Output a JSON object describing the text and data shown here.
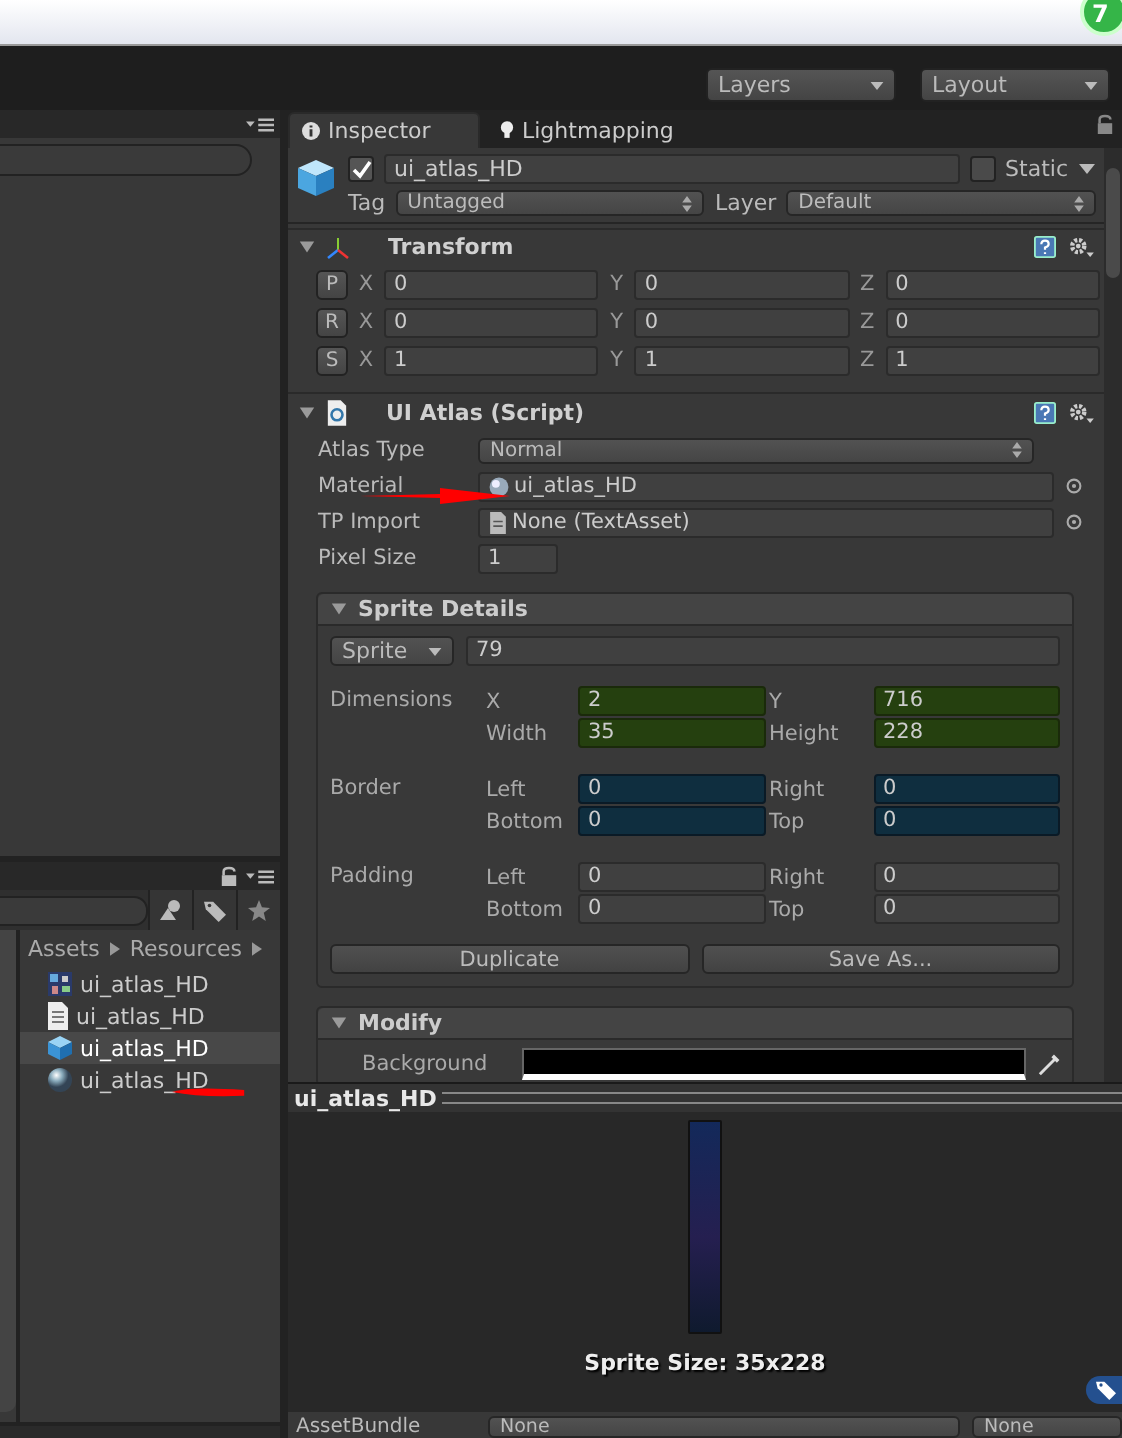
{
  "badge": "7",
  "toolbar": {
    "dropdowns": [
      "Layers",
      "Layout"
    ]
  },
  "project": {
    "breadcrumb": [
      "Assets",
      "Resources"
    ],
    "items": [
      {
        "name": "ui_atlas_HD",
        "kind": "atlas",
        "selected": false
      },
      {
        "name": "ui_atlas_HD",
        "kind": "text",
        "selected": false
      },
      {
        "name": "ui_atlas_HD",
        "kind": "prefab",
        "selected": true
      },
      {
        "name": "ui_atlas_HD",
        "kind": "material",
        "selected": false
      }
    ]
  },
  "inspector": {
    "tabs": [
      {
        "label": "Inspector",
        "kind": "info",
        "selected": true
      },
      {
        "label": "Lightmapping",
        "kind": "bulb",
        "selected": false
      }
    ],
    "object": {
      "active": true,
      "name": "ui_atlas_HD",
      "static": false,
      "static_label": "Static",
      "tag_label": "Tag",
      "tag": "Untagged",
      "layer_label": "Layer",
      "layer": "Default"
    },
    "transform": {
      "title": "Transform",
      "expanded": true,
      "rows": [
        {
          "button": "P",
          "values": [
            {
              "axis": "X",
              "value": "0"
            },
            {
              "axis": "Y",
              "value": "0"
            },
            {
              "axis": "Z",
              "value": "0"
            }
          ]
        },
        {
          "button": "R",
          "values": [
            {
              "axis": "X",
              "value": "0"
            },
            {
              "axis": "Y",
              "value": "0"
            },
            {
              "axis": "Z",
              "value": "0"
            }
          ]
        },
        {
          "button": "S",
          "values": [
            {
              "axis": "X",
              "value": "1"
            },
            {
              "axis": "Y",
              "value": "1"
            },
            {
              "axis": "Z",
              "value": "1"
            }
          ]
        }
      ]
    },
    "atlas": {
      "title": "UI Atlas (Script)",
      "expanded": true,
      "fields": [
        {
          "label": "Atlas Type",
          "kind": "dropdown",
          "value": "Normal"
        },
        {
          "label": "Material",
          "kind": "material",
          "value": "ui_atlas_HD"
        },
        {
          "label": "TP Import",
          "kind": "text",
          "value": "None (TextAsset)"
        },
        {
          "label": "Pixel Size",
          "kind": "number",
          "value": "1"
        }
      ],
      "sprite_details": {
        "title": "Sprite Details",
        "expanded": true,
        "dropdown": "Sprite",
        "name": "79",
        "groups": [
          {
            "label": "Dimensions",
            "kind": "dimensions",
            "fields": [
              {
                "label": "X",
                "value": "2"
              },
              {
                "label": "Y",
                "value": "716"
              },
              {
                "label": "Width",
                "value": "35"
              },
              {
                "label": "Height",
                "value": "228"
              }
            ]
          },
          {
            "label": "Border",
            "kind": "border",
            "fields": [
              {
                "label": "Left",
                "value": "0"
              },
              {
                "label": "Right",
                "value": "0"
              },
              {
                "label": "Bottom",
                "value": "0"
              },
              {
                "label": "Top",
                "value": "0"
              }
            ]
          },
          {
            "label": "Padding",
            "kind": "padding",
            "fields": [
              {
                "label": "Left",
                "value": "0"
              },
              {
                "label": "Right",
                "value": "0"
              },
              {
                "label": "Bottom",
                "value": "0"
              },
              {
                "label": "Top",
                "value": "0"
              }
            ]
          }
        ],
        "buttons": [
          "Duplicate",
          "Save As..."
        ]
      },
      "modify": {
        "title": "Modify",
        "expanded": true,
        "label": "Background",
        "color": "#000000"
      }
    }
  },
  "preview": {
    "title": "ui_atlas_HD",
    "caption": "Sprite Size: 35x228"
  },
  "asset_bundle": {
    "label": "AssetBundle",
    "values": [
      "None",
      "None"
    ]
  }
}
